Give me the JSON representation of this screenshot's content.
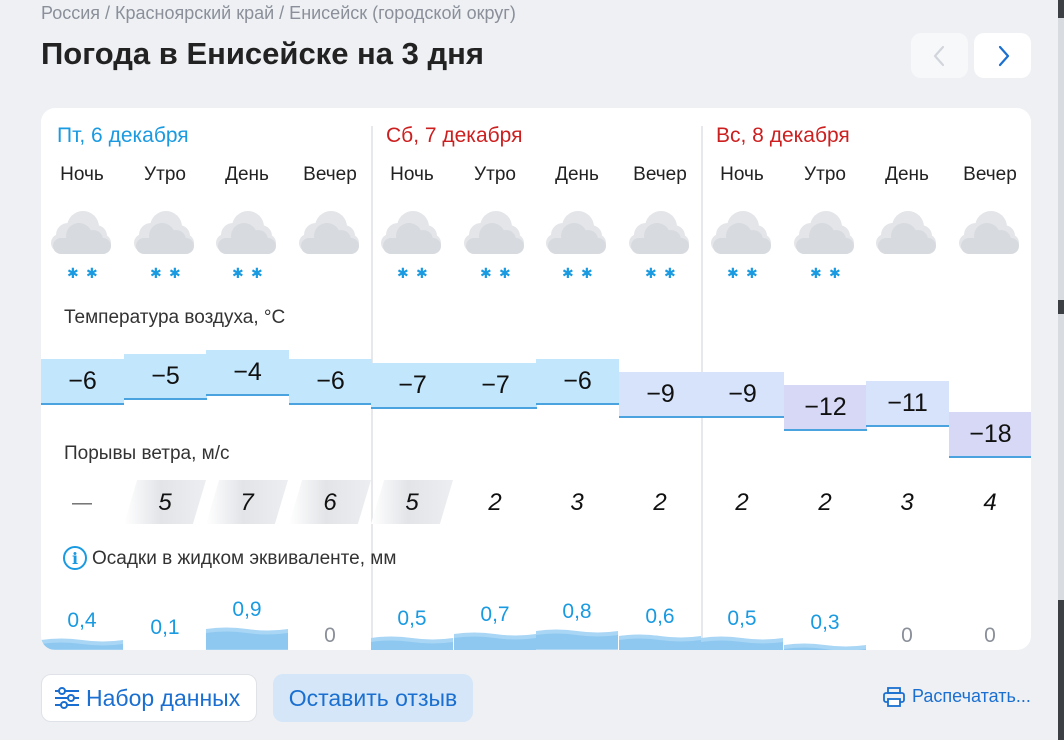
{
  "breadcrumb": "Россия / Красноярский край / Енисейск (городской округ)",
  "title": "Погода в Енисейске на 3 дня",
  "days": [
    {
      "label": "Пт, 6 декабря",
      "weekend": false
    },
    {
      "label": "Сб, 7 декабря",
      "weekend": true
    },
    {
      "label": "Вс, 8 декабря",
      "weekend": true
    }
  ],
  "parts": [
    {
      "label": "Ночь",
      "icon": "cloud-snow-icon",
      "temp": "−6",
      "wind": "—",
      "precip": "0,4",
      "precip_value": 0.4
    },
    {
      "label": "Утро",
      "icon": "cloud-snow-icon",
      "temp": "−5",
      "wind": "5",
      "precip": "0,1",
      "precip_value": 0.1
    },
    {
      "label": "День",
      "icon": "cloud-snow-icon",
      "temp": "−4",
      "wind": "7",
      "precip": "0,9",
      "precip_value": 0.9
    },
    {
      "label": "Вечер",
      "icon": "cloud-icon",
      "temp": "−6",
      "wind": "6",
      "precip": "0",
      "precip_value": 0
    },
    {
      "label": "Ночь",
      "icon": "cloud-snow-icon",
      "temp": "−7",
      "wind": "5",
      "precip": "0,5",
      "precip_value": 0.5
    },
    {
      "label": "Утро",
      "icon": "cloud-snow-icon",
      "temp": "−7",
      "wind": "2",
      "precip": "0,7",
      "precip_value": 0.7
    },
    {
      "label": "День",
      "icon": "cloud-snow-icon",
      "temp": "−6",
      "wind": "3",
      "precip": "0,8",
      "precip_value": 0.8
    },
    {
      "label": "Вечер",
      "icon": "cloud-snow-icon",
      "temp": "−9",
      "wind": "2",
      "precip": "0,6",
      "precip_value": 0.6
    },
    {
      "label": "Ночь",
      "icon": "cloud-snow-icon",
      "temp": "−9",
      "wind": "2",
      "precip": "0,5",
      "precip_value": 0.5
    },
    {
      "label": "Утро",
      "icon": "cloud-snow-icon",
      "temp": "−12",
      "wind": "2",
      "precip": "0,3",
      "precip_value": 0.3
    },
    {
      "label": "День",
      "icon": "cloud-icon",
      "temp": "−11",
      "wind": "3",
      "precip": "0",
      "precip_value": 0
    },
    {
      "label": "Вечер",
      "icon": "cloud-moon-icon",
      "temp": "−18",
      "wind": "4",
      "precip": "0",
      "precip_value": 0
    }
  ],
  "sections": {
    "temperature": "Температура воздуха, °C",
    "wind": "Порывы ветра, м/с",
    "precip": "Осадки в жидком эквиваленте, мм"
  },
  "buttons": {
    "dataset": "Набор данных",
    "feedback": "Оставить отзыв",
    "print": "Распечатать..."
  },
  "colors": {
    "weekday": "#1a9ae0",
    "weekend": "#cc1f1f",
    "link": "#1a6fd0",
    "snowflake": "#1a9ae0"
  }
}
